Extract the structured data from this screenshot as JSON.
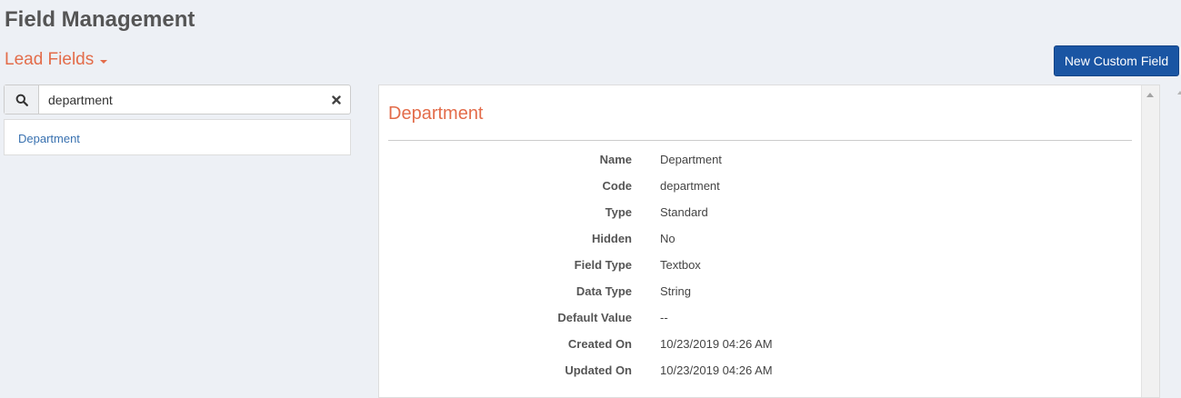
{
  "page": {
    "title": "Field Management"
  },
  "section": {
    "label": "Lead Fields"
  },
  "toolbar": {
    "new_custom_field_label": "New Custom Field"
  },
  "search": {
    "value": "department"
  },
  "results": [
    {
      "label": "Department"
    }
  ],
  "detail": {
    "title": "Department",
    "properties": [
      {
        "label": "Name",
        "value": "Department"
      },
      {
        "label": "Code",
        "value": "department"
      },
      {
        "label": "Type",
        "value": "Standard"
      },
      {
        "label": "Hidden",
        "value": "No"
      },
      {
        "label": "Field Type",
        "value": "Textbox"
      },
      {
        "label": "Data Type",
        "value": "String"
      },
      {
        "label": "Default Value",
        "value": "--"
      },
      {
        "label": "Created On",
        "value": "10/23/2019 04:26 AM"
      },
      {
        "label": "Updated On",
        "value": "10/23/2019 04:26 AM"
      }
    ]
  },
  "colors": {
    "accent": "#e36c4a",
    "primary_button": "#1a55a3",
    "link": "#3a72b0",
    "background": "#edf0f5"
  }
}
